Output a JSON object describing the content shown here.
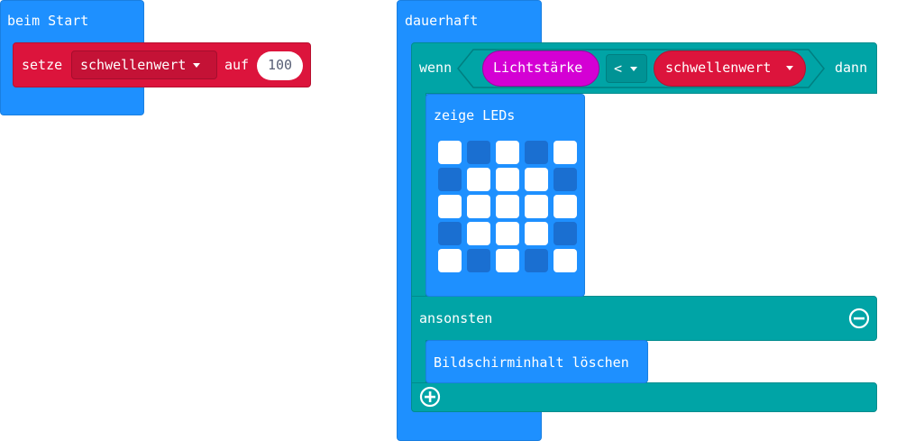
{
  "on_start": {
    "hat_label": "beim Start",
    "set_label": "setze",
    "variable": "schwellenwert",
    "to_label": "auf",
    "value": "100"
  },
  "forever": {
    "hat_label": "dauerhaft",
    "if_label": "wenn",
    "then_label": "dann",
    "sensor": "Lichtstärke",
    "operator": "<",
    "compare_variable": "schwellenwert",
    "show_leds_label": "zeige LEDs",
    "leds": [
      [
        1,
        0,
        1,
        0,
        1
      ],
      [
        0,
        1,
        1,
        1,
        0
      ],
      [
        1,
        1,
        1,
        1,
        1
      ],
      [
        0,
        1,
        1,
        1,
        0
      ],
      [
        1,
        0,
        1,
        0,
        1
      ]
    ],
    "else_label": "ansonsten",
    "clear_label": "Bildschirminhalt löschen"
  },
  "colors": {
    "basic_blue": "#1e90ff",
    "variables_red": "#dc143c",
    "logic_teal": "#00a4a6",
    "input_magenta": "#d400d4"
  }
}
